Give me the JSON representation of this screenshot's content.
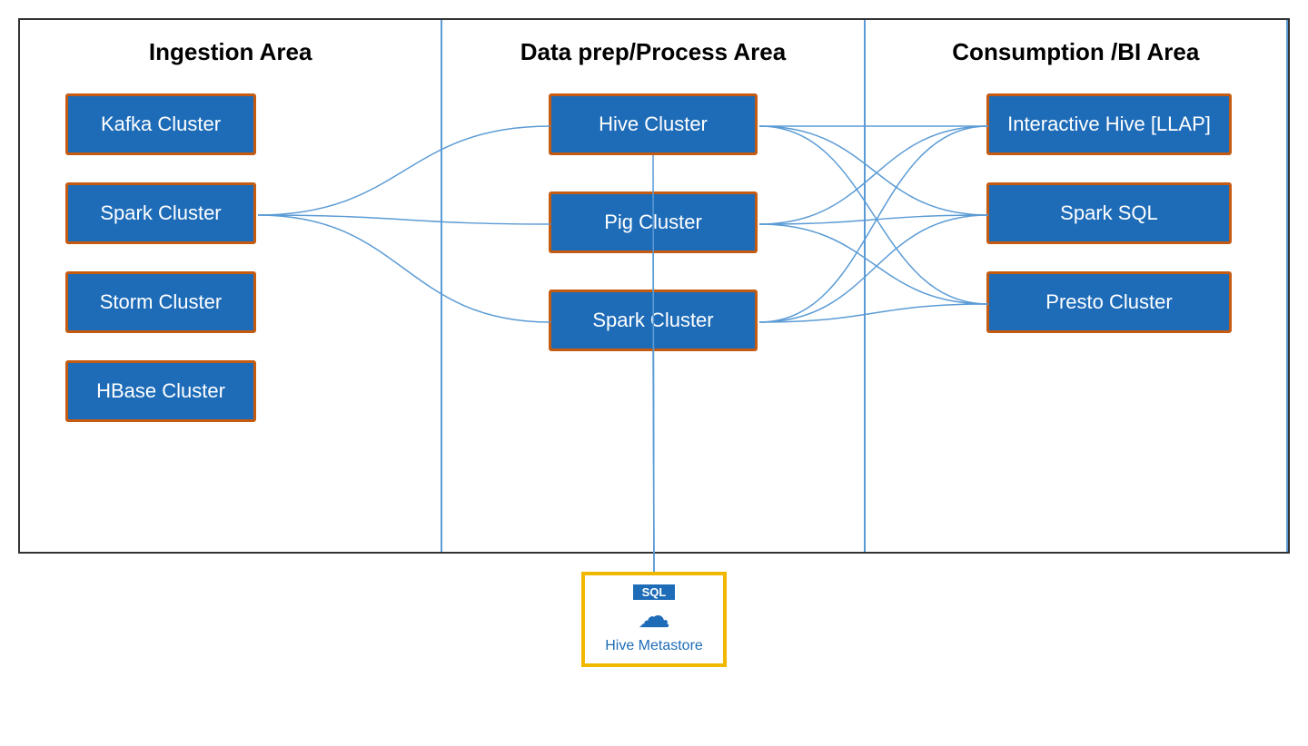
{
  "columns": [
    {
      "id": "ingestion",
      "title": "Ingestion Area",
      "clusters": [
        {
          "id": "kafka",
          "label": "Kafka Cluster"
        },
        {
          "id": "spark-ing",
          "label": "Spark Cluster"
        },
        {
          "id": "storm",
          "label": "Storm Cluster"
        },
        {
          "id": "hbase",
          "label": "HBase Cluster"
        }
      ]
    },
    {
      "id": "process",
      "title": "Data prep/Process Area",
      "clusters": [
        {
          "id": "hive-proc",
          "label": "Hive Cluster"
        },
        {
          "id": "pig",
          "label": "Pig Cluster"
        },
        {
          "id": "spark-proc",
          "label": "Spark Cluster"
        }
      ]
    },
    {
      "id": "consumption",
      "title": "Consumption /BI Area",
      "clusters": [
        {
          "id": "interactive-hive",
          "label": "Interactive Hive [LLAP]"
        },
        {
          "id": "spark-sql",
          "label": "Spark SQL"
        },
        {
          "id": "presto",
          "label": "Presto Cluster"
        }
      ]
    }
  ],
  "metastore": {
    "label": "Hive Metastore",
    "sql_label": "SQL"
  },
  "colors": {
    "cluster_bg": "#1e6cb8",
    "cluster_border": "#c55a11",
    "metastore_border": "#f0b800",
    "line_color": "#5b9bd5",
    "column_divider": "#5b9bd5",
    "title_color": "#000000"
  }
}
